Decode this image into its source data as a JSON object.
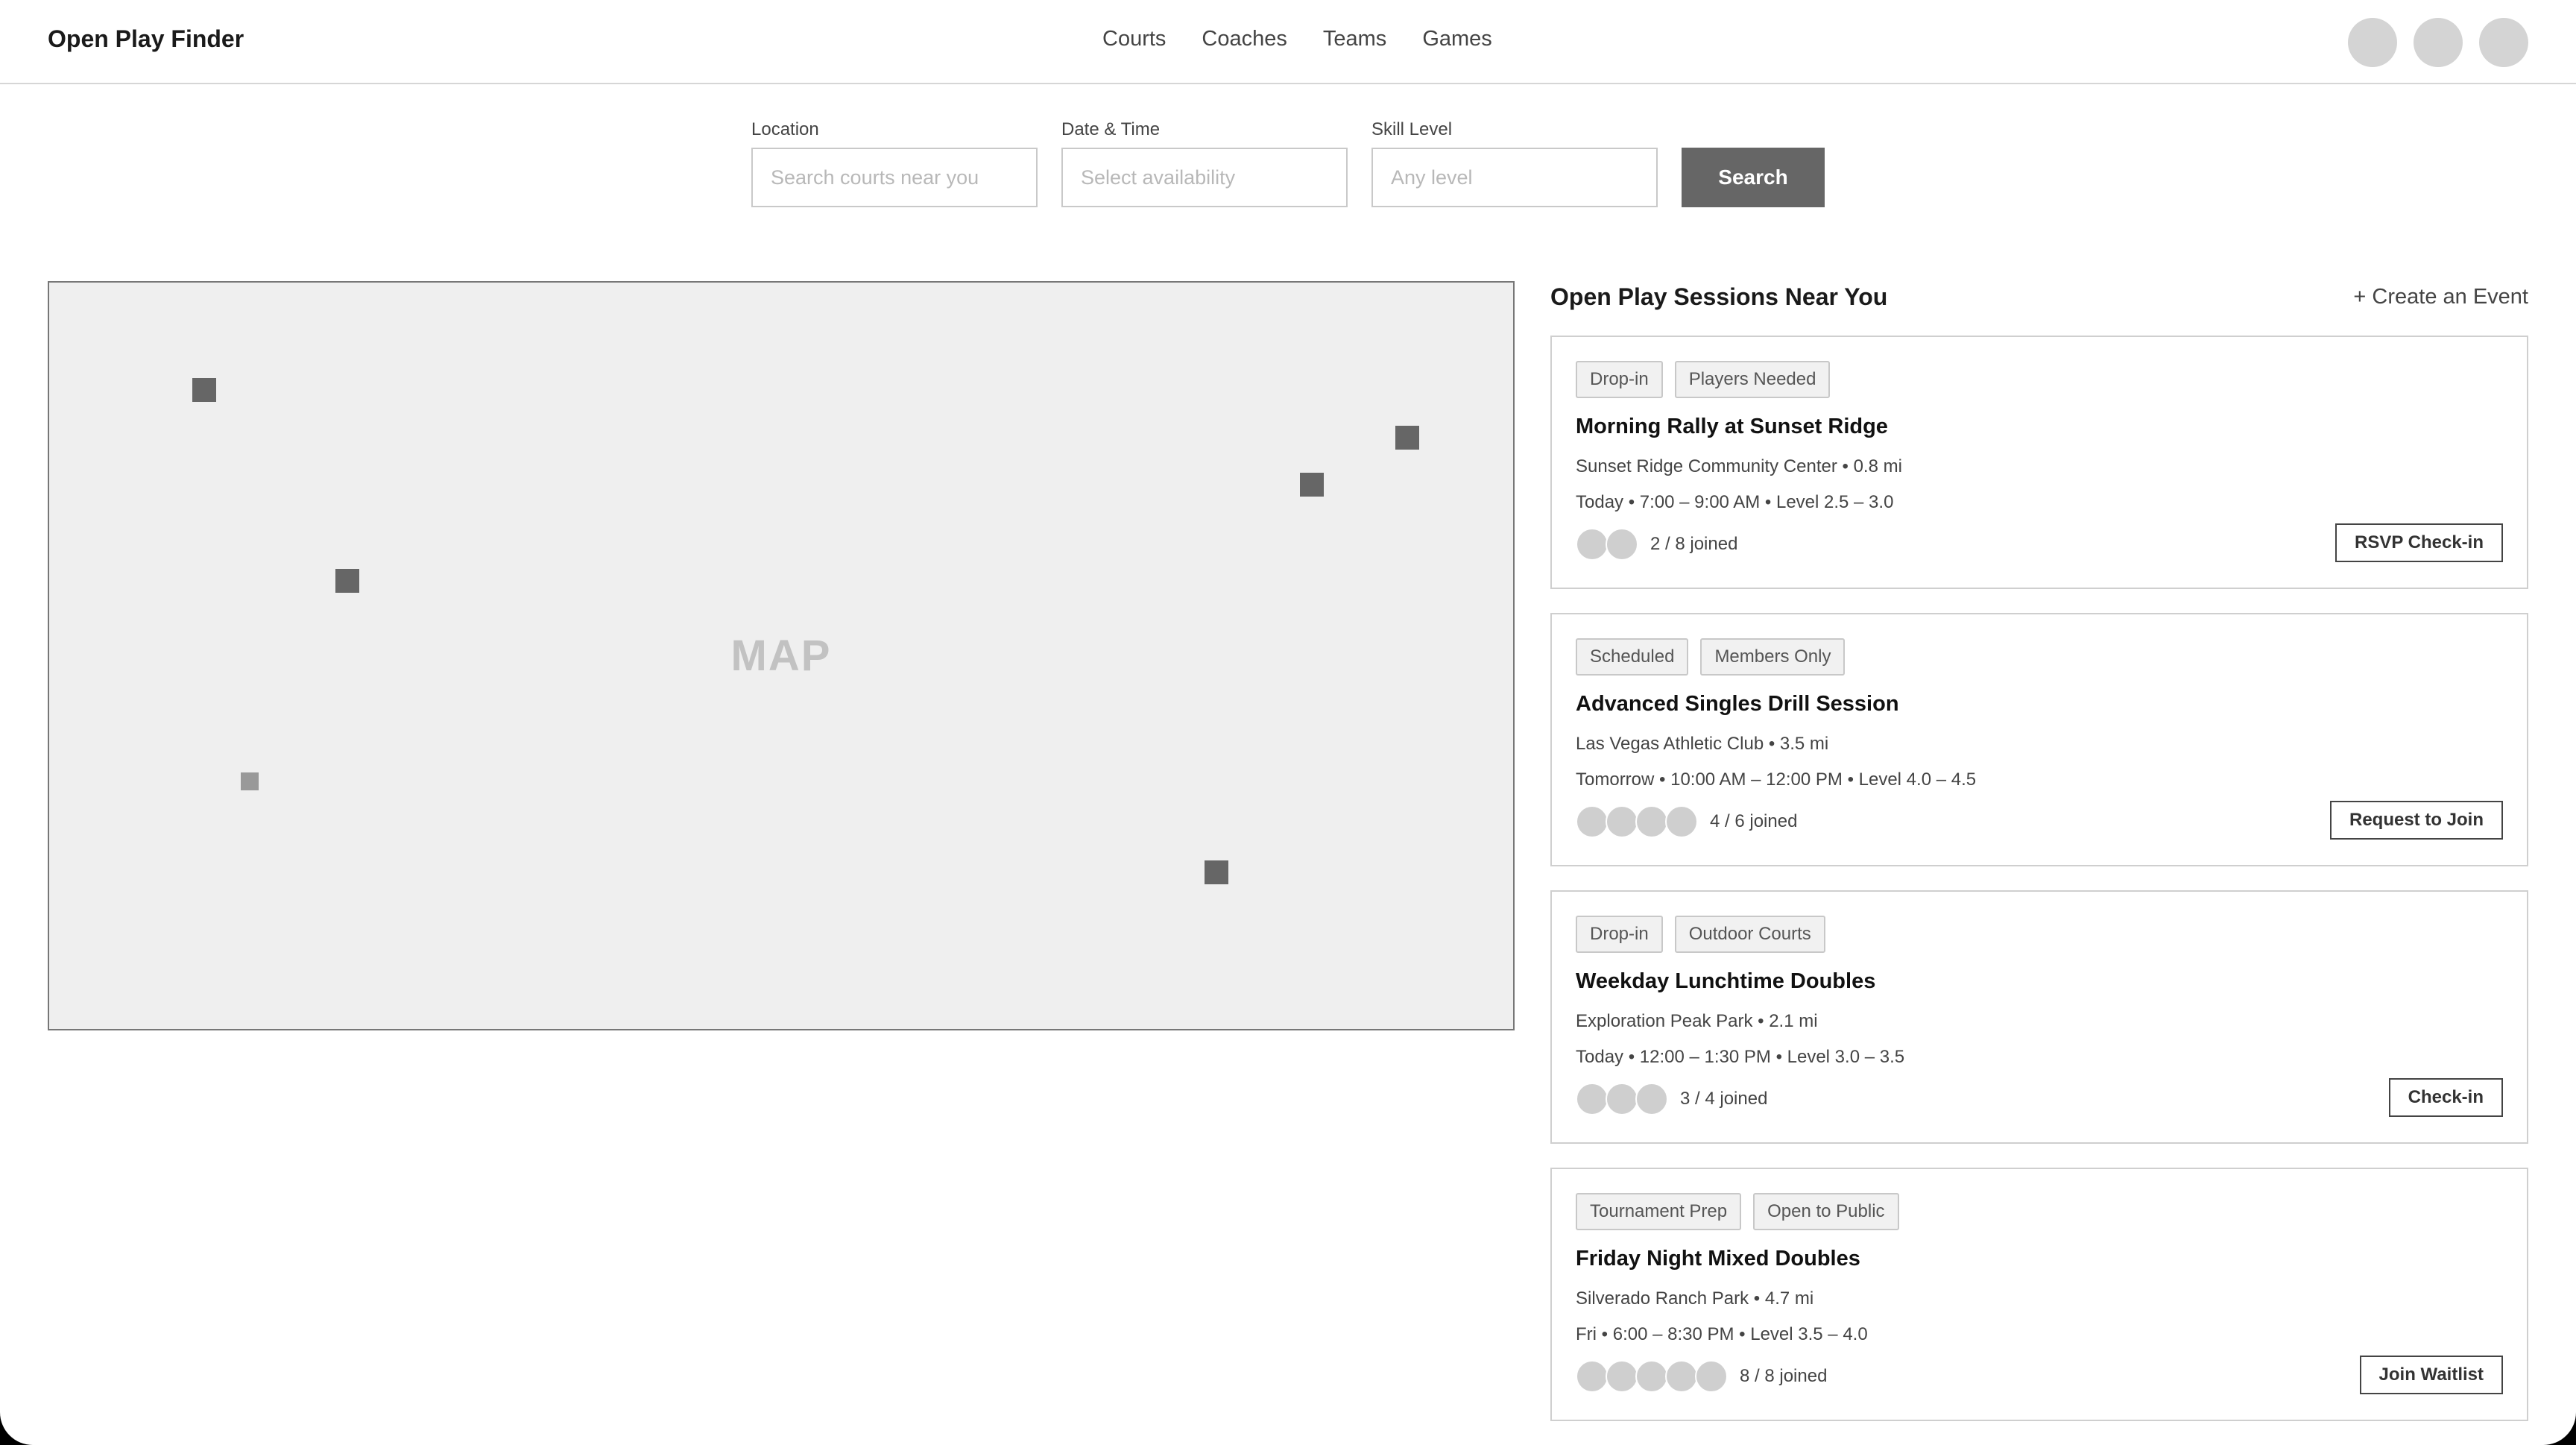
{
  "app": {
    "brand": "Open Play Finder"
  },
  "nav": [
    "Courts",
    "Coaches",
    "Teams",
    "Games"
  ],
  "search": {
    "location_label": "Location",
    "location_placeholder": "Search courts near you",
    "datetime_label": "Date & Time",
    "datetime_placeholder": "Select availability",
    "skill_label": "Skill Level",
    "skill_placeholder": "Any level",
    "button_label": "Search"
  },
  "map": {
    "label": "MAP"
  },
  "panel": {
    "title": "Open Play Sessions Near You",
    "create_label": "+ Create an Event"
  },
  "sessions": [
    {
      "tags": [
        "Drop-in",
        "Players Needed"
      ],
      "title": "Morning Rally at Sunset Ridge",
      "location": "Sunset Ridge Community Center • 0.8 mi",
      "time": "Today • 7:00 – 9:00 AM • Level 2.5 – 3.0",
      "joined": "2 / 8 joined",
      "avatar_count": 2,
      "button": "RSVP Check-in"
    },
    {
      "tags": [
        "Scheduled",
        "Members Only"
      ],
      "title": "Advanced Singles Drill Session",
      "location": "Las Vegas Athletic Club • 3.5 mi",
      "time": "Tomorrow • 10:00 AM – 12:00 PM • Level 4.0 – 4.5",
      "joined": "4 / 6 joined",
      "avatar_count": 4,
      "button": "Request to Join"
    },
    {
      "tags": [
        "Drop-in",
        "Outdoor Courts"
      ],
      "title": "Weekday Lunchtime Doubles",
      "location": "Exploration Peak Park • 2.1 mi",
      "time": "Today • 12:00 – 1:30 PM • Level 3.0 – 3.5",
      "joined": "3 / 4 joined",
      "avatar_count": 3,
      "button": "Check-in"
    },
    {
      "tags": [
        "Tournament Prep",
        "Open to Public"
      ],
      "title": "Friday Night Mixed Doubles",
      "location": "Silverado Ranch Park • 4.7 mi",
      "time": "Fri • 6:00 – 8:30 PM • Level 3.5 – 4.0",
      "joined": "8 / 8 joined",
      "avatar_count": 5,
      "button": "Join Waitlist"
    }
  ]
}
